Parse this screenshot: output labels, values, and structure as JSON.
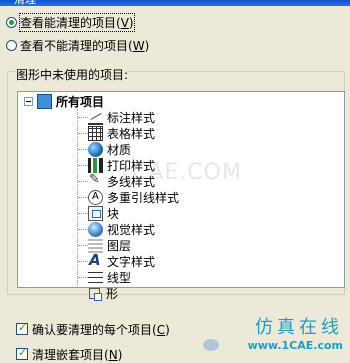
{
  "dialog": {
    "title": "清理",
    "view_options": [
      {
        "label": "查看能清理的项目",
        "key": "V",
        "selected": true
      },
      {
        "label": "查看不能清理的项目",
        "key": "W",
        "selected": false
      }
    ],
    "group_title": "图形中未使用的项目:",
    "tree": {
      "root_label": "所有项目",
      "items": [
        {
          "label": "标注样式",
          "icon": "dimension-style-icon"
        },
        {
          "label": "表格样式",
          "icon": "table-style-icon"
        },
        {
          "label": "材质",
          "icon": "material-icon"
        },
        {
          "label": "打印样式",
          "icon": "plot-style-icon"
        },
        {
          "label": "多线样式",
          "icon": "multiline-style-icon"
        },
        {
          "label": "多重引线样式",
          "icon": "multileader-style-icon"
        },
        {
          "label": "块",
          "icon": "block-icon"
        },
        {
          "label": "视觉样式",
          "icon": "visual-style-icon"
        },
        {
          "label": "图层",
          "icon": "layer-icon"
        },
        {
          "label": "文字样式",
          "icon": "text-style-icon"
        },
        {
          "label": "线型",
          "icon": "linetype-icon"
        },
        {
          "label": "形",
          "icon": "shape-icon"
        }
      ]
    },
    "confirm_each": {
      "label": "确认要清理的每个项目",
      "key": "C",
      "checked": true
    },
    "nested": {
      "label": "清理嵌套项目",
      "key": "N",
      "checked": true
    }
  },
  "watermark": {
    "center": "1CAE.COM",
    "brand_cn": "仿真在线",
    "brand_url": "www.1CAE.com"
  }
}
